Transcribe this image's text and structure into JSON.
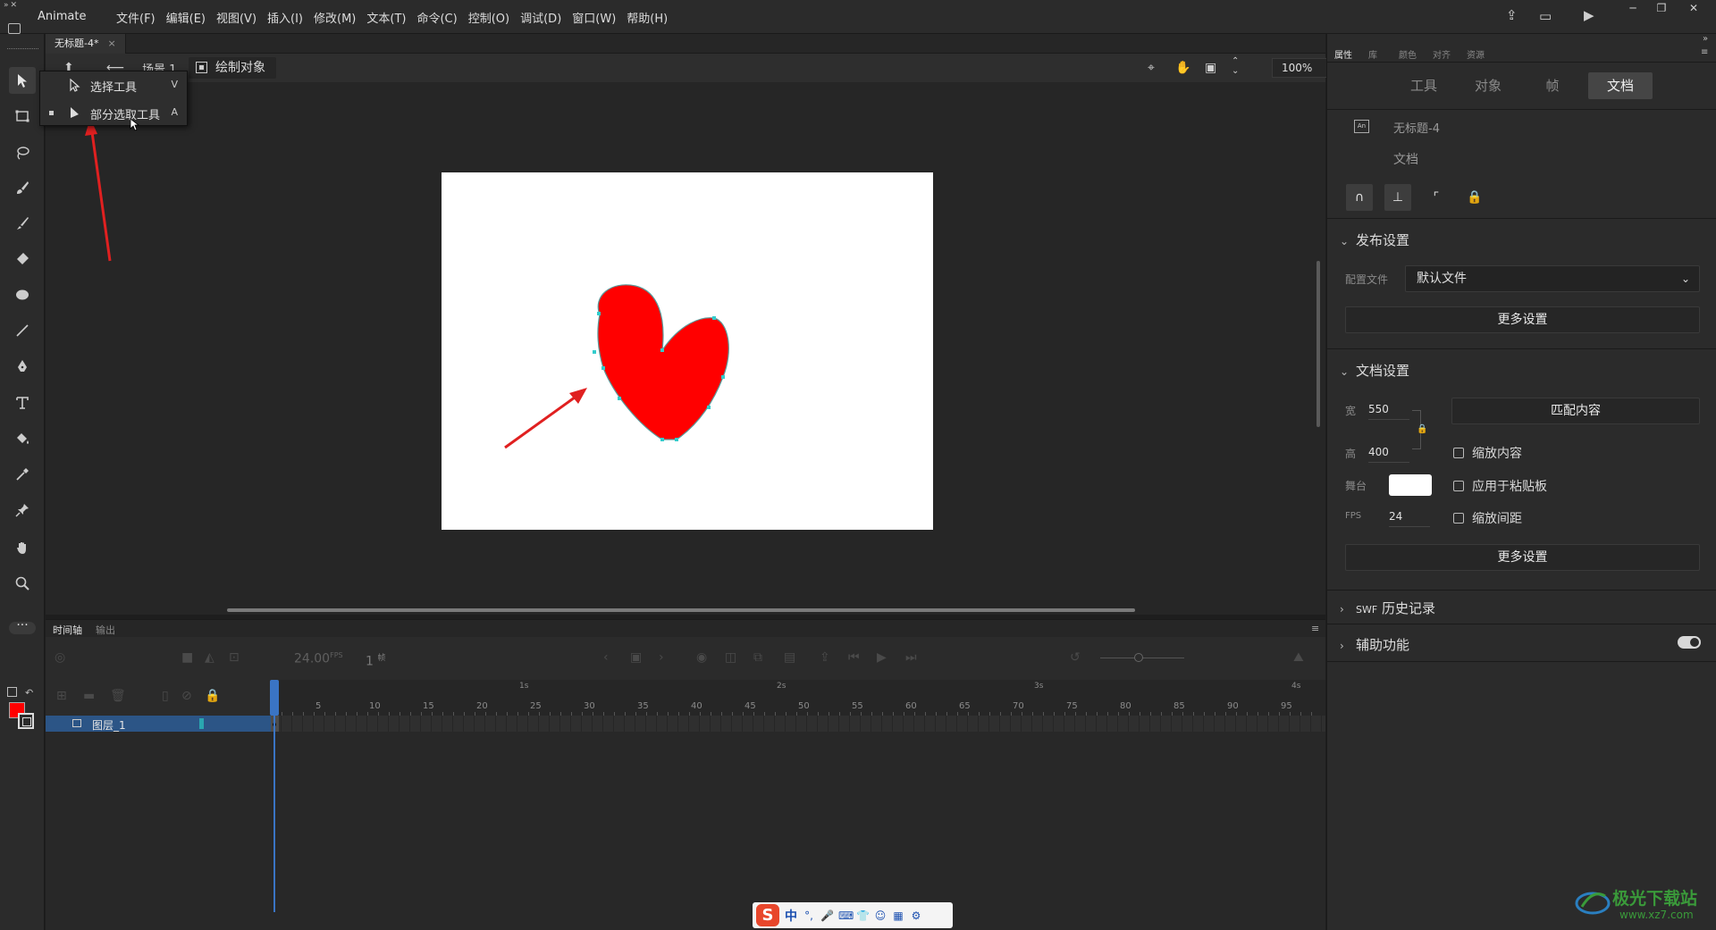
{
  "app": {
    "name": "Animate"
  },
  "menus": [
    "文件(F)",
    "编辑(E)",
    "视图(V)",
    "插入(I)",
    "修改(M)",
    "文本(T)",
    "命令(C)",
    "控制(O)",
    "调试(D)",
    "窗口(W)",
    "帮助(H)"
  ],
  "document": {
    "tab_title": "无标题-4*",
    "tab_close": "×"
  },
  "editbar": {
    "scene": "场景 1",
    "draw_object": "绘制对象",
    "zoom": "100%"
  },
  "flyout": {
    "items": [
      {
        "label": "选择工具",
        "key": "V"
      },
      {
        "label": "部分选取工具",
        "key": "A"
      }
    ]
  },
  "timeline": {
    "tabs": [
      "时间轴",
      "输出"
    ],
    "fps": "24.00",
    "fps_unit": "FPS",
    "current_frame": "1",
    "frame_unit": "帧",
    "ruler_numbers": [
      "5",
      "10",
      "15",
      "20",
      "25",
      "30",
      "35",
      "40",
      "45",
      "50",
      "55",
      "60",
      "65",
      "70",
      "75",
      "80",
      "85",
      "90",
      "95"
    ],
    "ruler_seconds": [
      "1s",
      "2s",
      "3s",
      "4s"
    ],
    "layer_name": "图层_1"
  },
  "right_panel": {
    "tabs": [
      "属性",
      "库",
      "颜色",
      "对齐",
      "资源"
    ],
    "subtabs": [
      "工具",
      "对象",
      "帧",
      "文档"
    ],
    "doc_icon": "An",
    "doc_name": "无标题-4",
    "doc_type": "文档",
    "publish": {
      "title": "发布设置",
      "profile_label": "配置文件",
      "profile_value": "默认文件",
      "more": "更多设置"
    },
    "doc_settings": {
      "title": "文档设置",
      "width_label": "宽",
      "width": "550",
      "height_label": "高",
      "height": "400",
      "match_content": "匹配内容",
      "scale_content": "缩放内容",
      "apply_pasteboard": "应用于粘贴板",
      "scale_spacing": "缩放间距",
      "stage_label": "舞台",
      "stage_color": "#ffffff",
      "fps_label": "FPS",
      "fps": "24",
      "more": "更多设置"
    },
    "swf_history": {
      "prefix": "SWF",
      "title": "历史记录"
    },
    "accessibility": {
      "title": "辅助功能",
      "enabled": true
    }
  },
  "ime": {
    "mode": "中",
    "punct": "°,"
  },
  "watermark": {
    "title": "极光下载站",
    "url": "www.xz7.com"
  },
  "colors": {
    "fill": "#ff0000",
    "heart": "#ff0000",
    "annotation_arrow": "#e02020",
    "selection_point": "#33cccc"
  }
}
